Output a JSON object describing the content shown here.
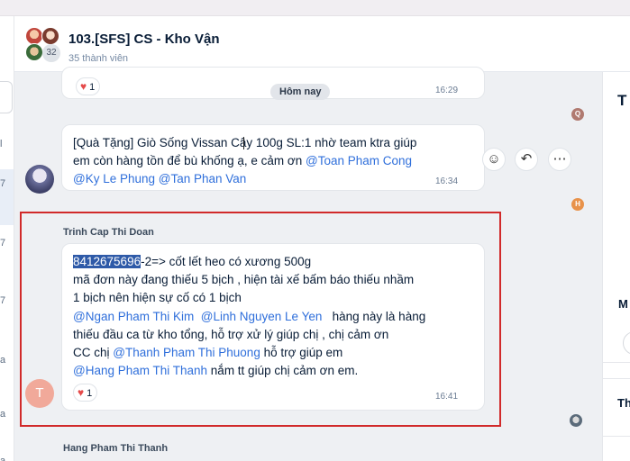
{
  "header": {
    "group_title": "103.[SFS] CS - Kho Vận",
    "member_count_label": "35 thành viên",
    "avatar_overflow_count": "32"
  },
  "left_panel": {
    "fragments": [
      "l",
      "7",
      "7",
      "7",
      "a",
      "a",
      "a"
    ]
  },
  "chat": {
    "date_divider": "Hôm nay",
    "prev_message": {
      "reaction_count": "1",
      "time": "16:29",
      "seen_by_initial": "Q"
    },
    "message1": {
      "lines": [
        "[Quà Tặng] Giò Sống Vissan Cây 100g SL:1 nhờ team ktra giúp",
        "em còn hàng tồn để bù khống ạ, e cảm ơn "
      ],
      "mention_toan": "@Toan Pham Cong",
      "mention_ky": "@Ky Le Phung",
      "mention_tan": "@Tan Phan Van",
      "time": "16:34",
      "seen_by_initial": "H",
      "actions": {
        "react_icon": "smile-icon",
        "reply_icon": "reply-icon",
        "more_icon": "more-icon"
      }
    },
    "message2": {
      "sender": "Trinh Cap Thi Doan",
      "selected_code": "8412675696",
      "line1_rest": "-2=> cốt lết heo có xương 500g",
      "line2": "mã đơn này đang thiếu 5 bịch , hiện tài xế bấm báo thiếu nhầm",
      "line3": "1 bịch nên hiện sự cố có 1 bịch",
      "mention_ngan": "@Ngan Pham Thi Kim",
      "mention_linh": "@Linh Nguyen Le Yen",
      "line4_rest": "hàng này là hàng",
      "line5": "thiếu đầu ca từ kho tổng, hỗ trợ xử lý giúp chị , chị cảm ơn",
      "line6_pre": "CC chị ",
      "mention_thanh": "@Thanh Pham Thi Phuong",
      "line6_rest": " hỗ trợ giúp em",
      "mention_hang": "@Hang Pham Thi Thanh",
      "line7_rest": " nắm tt giúp chị cảm ơn em.",
      "reaction_count": "1",
      "time": "16:41",
      "avatar_initial": "T"
    },
    "next_sender": "Hang Pham Thi Thanh"
  },
  "right_panel": {
    "title_fragment": "T",
    "section_fragment": "M",
    "section2_fragment": "Th"
  },
  "colors": {
    "mention": "#2f6fdb",
    "highlight_box": "#d12a2a",
    "selection": "#2e5aa8",
    "heart": "#e54a4a"
  }
}
